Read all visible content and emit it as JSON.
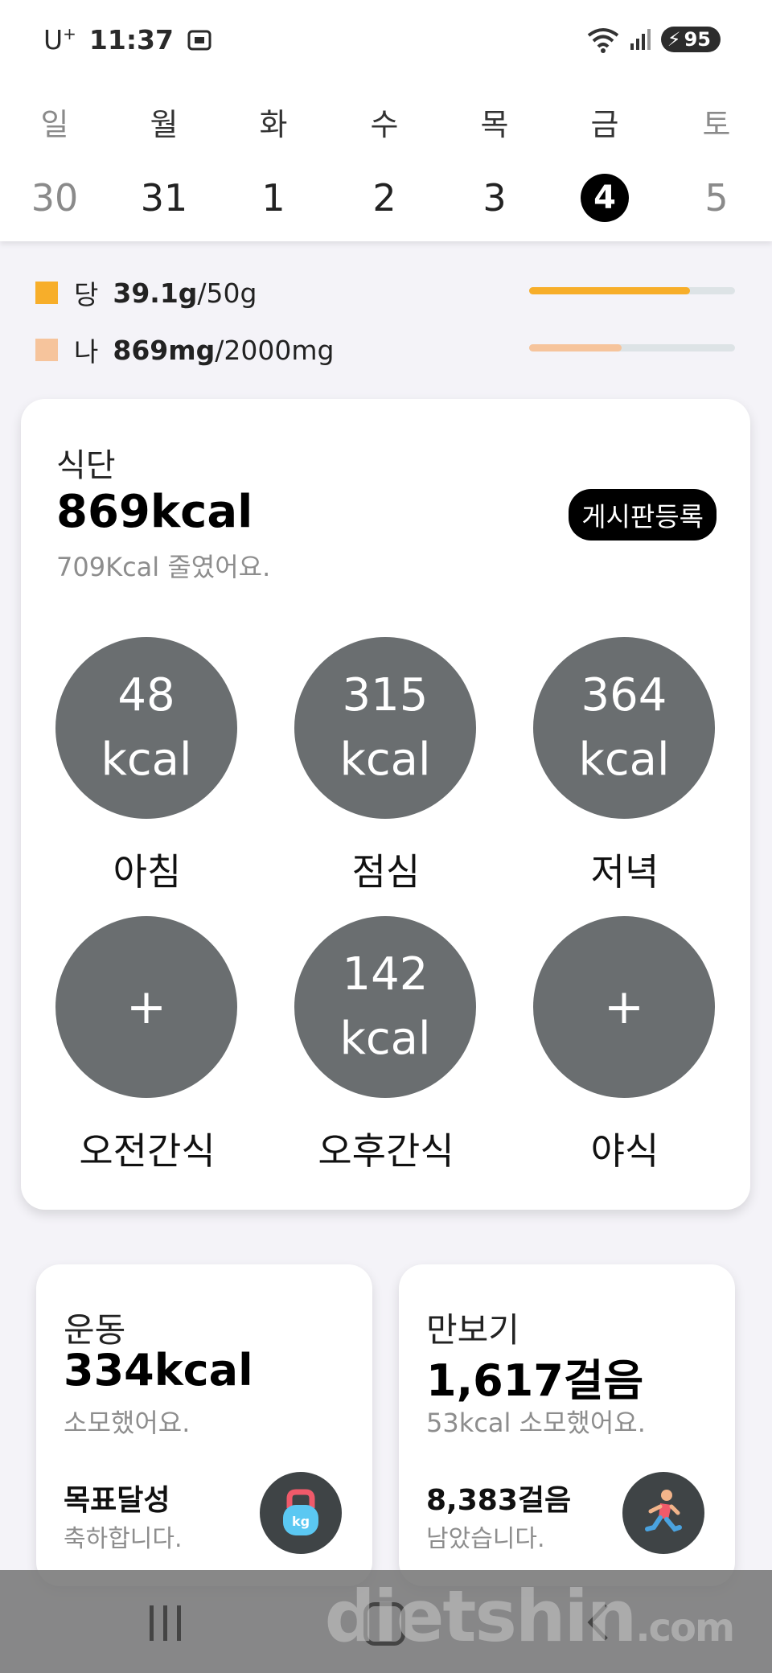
{
  "status_bar": {
    "carrier": "U",
    "carrier_sup": "+",
    "time": "11:37",
    "battery": "95"
  },
  "week": {
    "days": [
      {
        "name": "일",
        "num": "30"
      },
      {
        "name": "월",
        "num": "31"
      },
      {
        "name": "화",
        "num": "1"
      },
      {
        "name": "수",
        "num": "2"
      },
      {
        "name": "목",
        "num": "3"
      },
      {
        "name": "금",
        "num": "4"
      },
      {
        "name": "토",
        "num": "5"
      }
    ],
    "selected": "4"
  },
  "nutrients": [
    {
      "name": "당",
      "value": "39.1g",
      "goal": "/50g",
      "color": "#f7ae2a",
      "progress": 0.78
    },
    {
      "name": "나",
      "value": "869mg",
      "goal": "/2000mg",
      "color": "#f6c49c",
      "progress": 0.45
    }
  ],
  "diet": {
    "title": "식단",
    "kcal": "869kcal",
    "sub": "709Kcal 줄였어요.",
    "board_button": "게시판등록",
    "meals": [
      {
        "label": "아침",
        "value": "48",
        "unit": "kcal"
      },
      {
        "label": "점심",
        "value": "315",
        "unit": "kcal"
      },
      {
        "label": "저녁",
        "value": "364",
        "unit": "kcal"
      },
      {
        "label": "오전간식",
        "value": "+",
        "unit": ""
      },
      {
        "label": "오후간식",
        "value": "142",
        "unit": "kcal"
      },
      {
        "label": "야식",
        "value": "+",
        "unit": ""
      }
    ]
  },
  "exercise": {
    "title": "운동",
    "kcal": "334kcal",
    "sub": "소모했어요.",
    "foot": "목표달성",
    "foot2": "축하합니다.",
    "icon": "kettlebell-icon"
  },
  "steps": {
    "title": "만보기",
    "value": "1,617걸음",
    "sub": "53kcal 소모했어요.",
    "foot": "8,383걸음",
    "foot2": "남았습니다.",
    "icon": "runner-icon"
  },
  "watermark": {
    "main": "dietshin",
    "suffix": ".com"
  },
  "colors": {
    "circle": "#6a6e70",
    "accent_dark": "#000000"
  }
}
